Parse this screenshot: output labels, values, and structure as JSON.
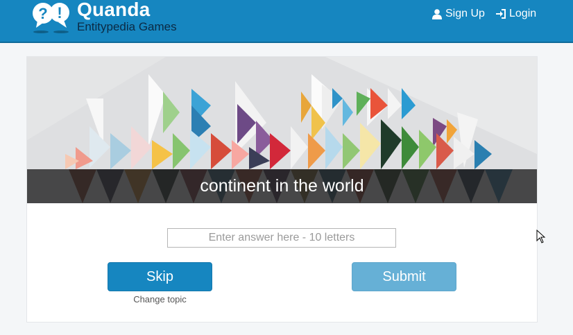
{
  "header": {
    "brand": "Quanda",
    "subtitle": "Entitypedia Games",
    "nav": {
      "signup": "Sign Up",
      "login": "Login"
    }
  },
  "game": {
    "clue": "continent in the world",
    "answer_placeholder": "Enter answer here - 10 letters",
    "answer_value": "",
    "skip_label": "Skip",
    "submit_label": "Submit",
    "change_topic": "Change topic"
  },
  "colors": {
    "brand_blue": "#1686c0",
    "submit_disabled": "#66b0d6"
  }
}
